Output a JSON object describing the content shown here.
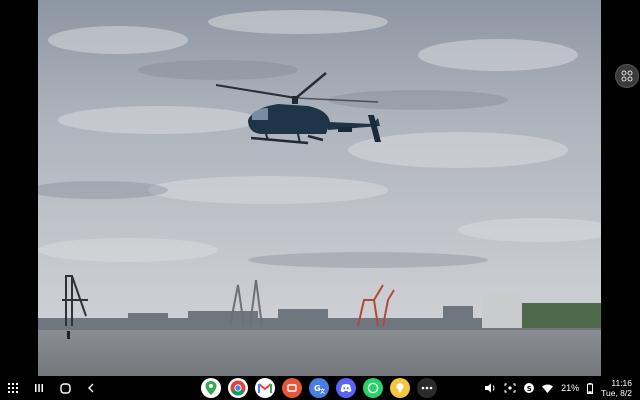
{
  "viewer": {
    "photo_description_icon": "photo"
  },
  "taskbar": {
    "apps": [
      {
        "name": "Maps",
        "icon": "maps-icon",
        "color": "#ffffff"
      },
      {
        "name": "Chrome",
        "icon": "chrome-icon",
        "color": "#ffffff"
      },
      {
        "name": "Gmail",
        "icon": "gmail-icon",
        "color": "#ffffff"
      },
      {
        "name": "Slides",
        "icon": "slides-icon",
        "color": "#e2563c"
      },
      {
        "name": "Translate",
        "icon": "translate-icon",
        "color": "#4a7fe0"
      },
      {
        "name": "Discord",
        "icon": "discord-icon",
        "color": "#5865f2"
      },
      {
        "name": "WhatsApp",
        "icon": "whatsapp-icon",
        "color": "#25d366"
      },
      {
        "name": "Keep",
        "icon": "keep-icon",
        "color": "#f6c63e"
      }
    ],
    "status": {
      "battery": "21%",
      "time": "11:16",
      "date": "Tue, 8/2"
    }
  },
  "colors": {
    "sky": "#b7bcc4",
    "water": "#7f8387",
    "taskbar": "#000000"
  }
}
